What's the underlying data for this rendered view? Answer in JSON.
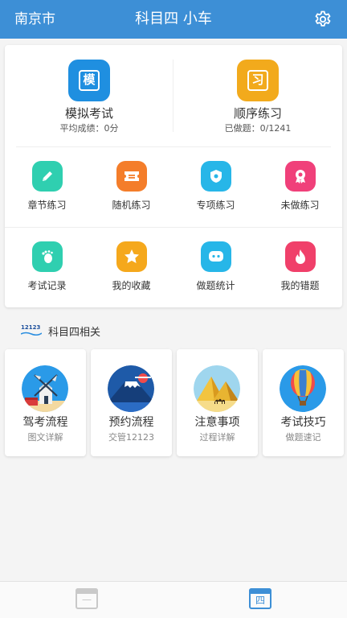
{
  "header": {
    "city": "南京市",
    "title": "科目四 小车",
    "settings_icon": "gear-icon",
    "bg_color": "#3d8fd6"
  },
  "top": [
    {
      "label": "模拟考试",
      "sub": "平均成绩：0分",
      "glyph": "模",
      "color": "#1f8fe0",
      "icon": "exam-icon"
    },
    {
      "label": "顺序练习",
      "sub": "已做题：0/1241",
      "glyph": "习",
      "color": "#f2aa1c",
      "icon": "practice-icon"
    }
  ],
  "grid_row1": [
    {
      "label": "章节练习",
      "color": "#2fcfb0",
      "icon": "pencil-icon"
    },
    {
      "label": "随机练习",
      "color": "#f47d2a",
      "icon": "ticket-icon"
    },
    {
      "label": "专项练习",
      "color": "#27b6e8",
      "icon": "shield-icon"
    },
    {
      "label": "未做练习",
      "color": "#f0407a",
      "icon": "badge-icon"
    }
  ],
  "grid_row2": [
    {
      "label": "考试记录",
      "color": "#2fcfb0",
      "icon": "footprint-icon"
    },
    {
      "label": "我的收藏",
      "color": "#f5a81c",
      "icon": "star-icon"
    },
    {
      "label": "做题统计",
      "color": "#27b6e8",
      "icon": "chat-icon"
    },
    {
      "label": "我的错题",
      "color": "#f0406a",
      "icon": "fire-icon"
    }
  ],
  "section": {
    "logo_text": "12123",
    "title": "科目四相关"
  },
  "cards": [
    {
      "title": "驾考流程",
      "sub": "图文详解",
      "icon": "windmill-icon"
    },
    {
      "title": "预约流程",
      "sub": "交管12123",
      "icon": "mount-fuji-icon"
    },
    {
      "title": "注意事项",
      "sub": "过程详解",
      "icon": "pyramid-icon"
    },
    {
      "title": "考试技巧",
      "sub": "做题速记",
      "icon": "balloon-icon"
    }
  ],
  "nav": [
    {
      "glyph": "一",
      "icon": "calendar-one-icon",
      "active": false,
      "color": "#c9c9c9"
    },
    {
      "glyph": "四",
      "icon": "calendar-four-icon",
      "active": true,
      "color": "#3d8fd6"
    }
  ]
}
